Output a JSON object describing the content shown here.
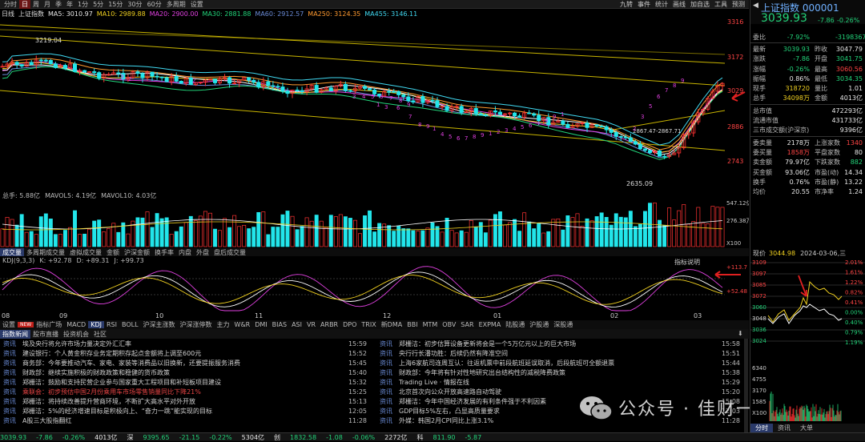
{
  "toolbar": {
    "left": [
      "分时",
      "日",
      "周",
      "月",
      "季",
      "年",
      "1分",
      "5分",
      "15分",
      "30分",
      "60分",
      "多周期",
      "设置"
    ],
    "active": 1,
    "right": [
      "九转",
      "事件",
      "统计",
      "画线",
      "加自选",
      "工具",
      "预测"
    ]
  },
  "ma_line": {
    "label": "日线",
    "name": "上证指数",
    "ma5": "MA5: 3010.97",
    "ma10": "MA10: 2989.88",
    "ma20": "MA20: 2900.00",
    "ma30": "MA30: 2881.88",
    "ma60": "MA60: 2912.57",
    "ma250": "MA250: 3124.35",
    "ma455": "MA455: 3146.11"
  },
  "price_axis": [
    "3316",
    "3172",
    "3029",
    "2886",
    "2743"
  ],
  "price_labels": {
    "high": "3219.04",
    "low": "2635.09",
    "mid": "2867.47-2867.71"
  },
  "td_marks": [
    "3",
    "2",
    "2",
    "3",
    "4",
    "5",
    "6",
    "7",
    "8",
    "9",
    "1",
    "3",
    "6",
    "7",
    "8",
    "9",
    "1",
    "4",
    "5",
    "6",
    "7",
    "8",
    "9",
    "1",
    "2",
    "3",
    "4",
    "5",
    "6",
    "7",
    "8",
    "9",
    "1",
    "2",
    "3",
    "5",
    "6",
    "7",
    "8",
    "9"
  ],
  "volume_header": {
    "label": "总手: 5.88亿",
    "mavol5": "MAVOL5: 4.19亿",
    "mavol10": "MAVOL10: 4.03亿"
  },
  "volume_axis": [
    "547.12亿",
    "276.38万",
    "X100"
  ],
  "vol_tabs": [
    "成交量",
    "多周期成交量",
    "虚拟成交量",
    "金额",
    "沪深金额",
    "换手率",
    "内盘",
    "外盘",
    "盘后成交量"
  ],
  "vol_tab_active": 0,
  "kdj_header": {
    "label": "KDJ(9,3,3)",
    "k": "K: +92.78",
    "d": "D: +89.31",
    "j": "J: +99.73",
    "link": "指标说明"
  },
  "kdj_axis": [
    "+113.7",
    "+52.48"
  ],
  "x_axis": [
    "08",
    "09",
    "10",
    "11",
    "12",
    "01",
    "02",
    "03"
  ],
  "ind_tabs": [
    "设置",
    "NEW",
    "指标广场",
    "MACD",
    "KDJ",
    "RSI",
    "BOLL",
    "沪深主涨数",
    "沪深涨停数",
    "主力",
    "W&R",
    "DMI",
    "BIAS",
    "ASI",
    "VR",
    "ARBR",
    "DPO",
    "TRIX",
    "新DMA",
    "BBI",
    "MTM",
    "OBV",
    "SAR",
    "EXPMA",
    "陆股通",
    "沪股通",
    "深股通"
  ],
  "ind_tab_active": 4,
  "news_tabs": [
    "指数新闻",
    "股市直播",
    "投资机会",
    "社区"
  ],
  "news_left": [
    {
      "cat": "资讯",
      "title": "埃及央行将允许市场力量决定外汇汇率",
      "time": "15:59",
      "red": false
    },
    {
      "cat": "资讯",
      "title": "建设银行：个人黄金积存业务定期积存起点金额将上调至600元",
      "time": "15:52",
      "red": false
    },
    {
      "cat": "资讯",
      "title": "商务部：今年要推动汽车、家电、家装等消费品以旧换新，还要提振服务消费",
      "time": "15:45",
      "red": false
    },
    {
      "cat": "资讯",
      "title": "财政部：继续实施积极的财政政策和稳健的货币政策",
      "time": "15:40",
      "red": false
    },
    {
      "cat": "资讯",
      "title": "郑栅洁：鼓励和支持民营企业参与国家重大工程项目和补短板项目建设",
      "time": "15:32",
      "red": false
    },
    {
      "cat": "资讯",
      "title": "乘联会：初步预估中国2月份乘用车市场零售销量同比下降21%",
      "time": "15:25",
      "red": true
    },
    {
      "cat": "资讯",
      "title": "郑栅洁：将持续改善提升营商环境，不断扩大高水平对外开放",
      "time": "15:13",
      "red": false
    },
    {
      "cat": "资讯",
      "title": "郑栅洁：5%的经济增速目标是积极向上、“奋力一跳”能实现的目标",
      "time": "12:05",
      "red": false
    },
    {
      "cat": "资讯",
      "title": "A股三大股指翻红",
      "time": "11:28",
      "red": false
    }
  ],
  "news_right": [
    {
      "cat": "资讯",
      "title": "郑栅洁：初步估算设备更新将会是一个5万亿元以上的巨大市场",
      "time": "15:58",
      "red": false
    },
    {
      "cat": "资讯",
      "title": "央行行长潘功胜：后续仍然有降准空间",
      "time": "15:51",
      "red": false
    },
    {
      "cat": "资讯",
      "title": "上海6家航司连周互认：往返机票中前段航班延误取消，后段航班可全额退票",
      "time": "15:44",
      "red": false
    },
    {
      "cat": "资讯",
      "title": "财政部：今年将有针对性地研究出台结构性的减税降费政策",
      "time": "15:38",
      "red": false
    },
    {
      "cat": "资讯",
      "title": "Trading Live · 情报在线",
      "time": "15:29",
      "red": false
    },
    {
      "cat": "资讯",
      "title": "北京首次向公众开放高速路自动驾驶",
      "time": "15:20",
      "red": false
    },
    {
      "cat": "资讯",
      "title": "郑栅洁：今年中国经济发展的有利条件强于不利因素",
      "time": "15:08",
      "red": false
    },
    {
      "cat": "资讯",
      "title": "GDP目标5%左右，凸显高质量要求",
      "time": "12:03",
      "red": false
    },
    {
      "cat": "资讯",
      "title": "外媒：韩国2月CPI同比上涨3.1%",
      "time": "11:28",
      "red": false
    }
  ],
  "watermark": "公众号 · 佳财一分钟",
  "status_bar": [
    {
      "text": "3039.93",
      "c": "grn"
    },
    {
      "text": "-7.86",
      "c": "grn"
    },
    {
      "text": "-0.26%",
      "c": "grn"
    },
    {
      "text": "4013亿",
      "c": "wht"
    },
    {
      "text": "深",
      "c": "wht"
    },
    {
      "text": "9395.65",
      "c": "grn"
    },
    {
      "text": "-21.15",
      "c": "grn"
    },
    {
      "text": "-0.22%",
      "c": "grn"
    },
    {
      "text": "5304亿",
      "c": "wht"
    },
    {
      "text": "创",
      "c": "wht"
    },
    {
      "text": "1832.58",
      "c": "grn"
    },
    {
      "text": "-1.08",
      "c": "grn"
    },
    {
      "text": "-0.06%",
      "c": "grn"
    },
    {
      "text": "2272亿",
      "c": "wht"
    },
    {
      "text": "科",
      "c": "wht"
    },
    {
      "text": "811.90",
      "c": "grn"
    },
    {
      "text": "-5.87",
      "c": "grn"
    }
  ],
  "rp": {
    "title": "上证指数 000001",
    "price": "3039.93",
    "chg": "-7.86",
    "pct": "-0.26%",
    "rows": [
      {
        "l1": "委比",
        "v1": "-7.92%",
        "c1": "grn",
        "l2": "",
        "v2": "-3198367",
        "c2": "grn"
      },
      {
        "l1": "最新",
        "v1": "3039.93",
        "c1": "grn",
        "l2": "昨收",
        "v2": "3047.79",
        "c2": "wht"
      },
      {
        "l1": "涨跌",
        "v1": "-7.86",
        "c1": "grn",
        "l2": "开盘",
        "v2": "3041.75",
        "c2": "grn"
      },
      {
        "l1": "涨幅",
        "v1": "-0.26%",
        "c1": "grn",
        "l2": "最高",
        "v2": "3060.56",
        "c2": "red"
      },
      {
        "l1": "振幅",
        "v1": "0.86%",
        "c1": "wht",
        "l2": "最低",
        "v2": "3034.35",
        "c2": "grn"
      },
      {
        "l1": "现手",
        "v1": "318720",
        "c1": "yel",
        "l2": "量比",
        "v2": "1.01",
        "c2": "wht"
      },
      {
        "l1": "总手",
        "v1": "34098万",
        "c1": "yel",
        "l2": "金额",
        "v2": "4013亿",
        "c2": "wht"
      },
      {
        "l1": "总市值",
        "v1": "",
        "c1": "wht",
        "l2": "",
        "v2": "472293亿",
        "c2": "wht"
      },
      {
        "l1": "流通市值",
        "v1": "",
        "c1": "wht",
        "l2": "",
        "v2": "431733亿",
        "c2": "wht"
      },
      {
        "l1": "三市成交额(沪深京)",
        "v1": "",
        "c1": "wht",
        "l2": "",
        "v2": "9396亿",
        "c2": "wht"
      },
      {
        "l1": "委卖量",
        "v1": "2178万",
        "c1": "wht",
        "l2": "上涨家数",
        "v2": "1340",
        "c2": "red"
      },
      {
        "l1": "委买量",
        "v1": "1858万",
        "c1": "red",
        "l2": "平盘家数",
        "v2": "80",
        "c2": "wht"
      },
      {
        "l1": "卖金额",
        "v1": "79.97亿",
        "c1": "wht",
        "l2": "下跌家数",
        "v2": "882",
        "c2": "grn"
      },
      {
        "l1": "买金额",
        "v1": "93.06亿",
        "c1": "wht",
        "l2": "市盈(动)",
        "v2": "14.34",
        "c2": "wht"
      },
      {
        "l1": "换手",
        "v1": "0.76%",
        "c1": "wht",
        "l2": "市盈(静)",
        "v2": "13.22",
        "c2": "wht"
      },
      {
        "l1": "均价",
        "v1": "20.55",
        "c1": "wht",
        "l2": "市净率",
        "v2": "1.24",
        "c2": "wht"
      }
    ],
    "mini_header": {
      "label": "现价",
      "price": "3044.98",
      "date": "2024-03-06,三"
    },
    "mini_left": [
      "3109",
      "3097",
      "3085",
      "3072",
      "3060",
      "3048",
      "3036",
      "3024"
    ],
    "mini_right": [
      "2.01%",
      "1.61%",
      "1.22%",
      "0.82%",
      "0.41%",
      "0.00%",
      "0.40%",
      "0.79%",
      "1.19%"
    ],
    "mini_vol": [
      "6340",
      "4755",
      "3170",
      "1585",
      "X100"
    ],
    "mini_tabs": [
      "分时",
      "资讯",
      "大单"
    ]
  },
  "colors": {
    "up": "#ff3333",
    "down": "#22e5ea",
    "bg": "#000000",
    "ma5": "#ffffff",
    "ma10": "#f0d020",
    "ma20": "#e040e0",
    "ma30": "#22d47a",
    "ma60": "#6a8bd6",
    "ma250": "#ff9a30",
    "ma455": "#40d8f0",
    "arrow": "#e02020"
  }
}
